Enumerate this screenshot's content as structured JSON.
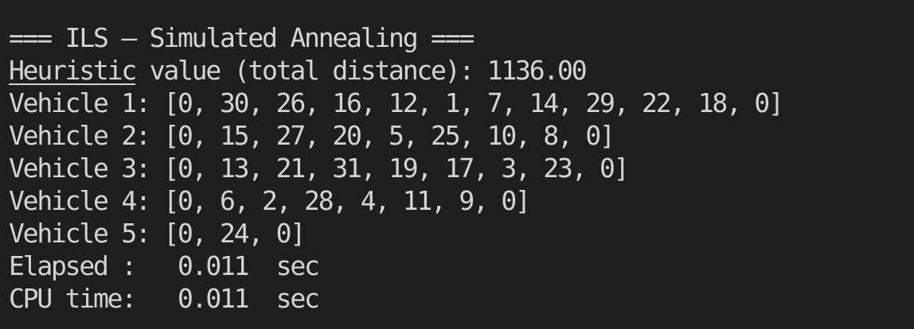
{
  "terminal": {
    "title_line": "=== ILS – Simulated Annealing ===",
    "heuristic_word": "Heuristic",
    "heuristic_rest": " value (total distance): 1136.00",
    "vehicles": [
      "Vehicle 1: [0, 30, 26, 16, 12, 1, 7, 14, 29, 22, 18, 0]",
      "Vehicle 2: [0, 15, 27, 20, 5, 25, 10, 8, 0]",
      "Vehicle 3: [0, 13, 21, 31, 19, 17, 3, 23, 0]",
      "Vehicle 4: [0, 6, 2, 28, 4, 11, 9, 0]",
      "Vehicle 5: [0, 24, 0]"
    ],
    "elapsed_line": "Elapsed :   0.011  sec",
    "cpu_line": "CPU time:   0.011  sec"
  },
  "colors": {
    "background": "#1e1e1e",
    "text": "#d4d4d4"
  }
}
